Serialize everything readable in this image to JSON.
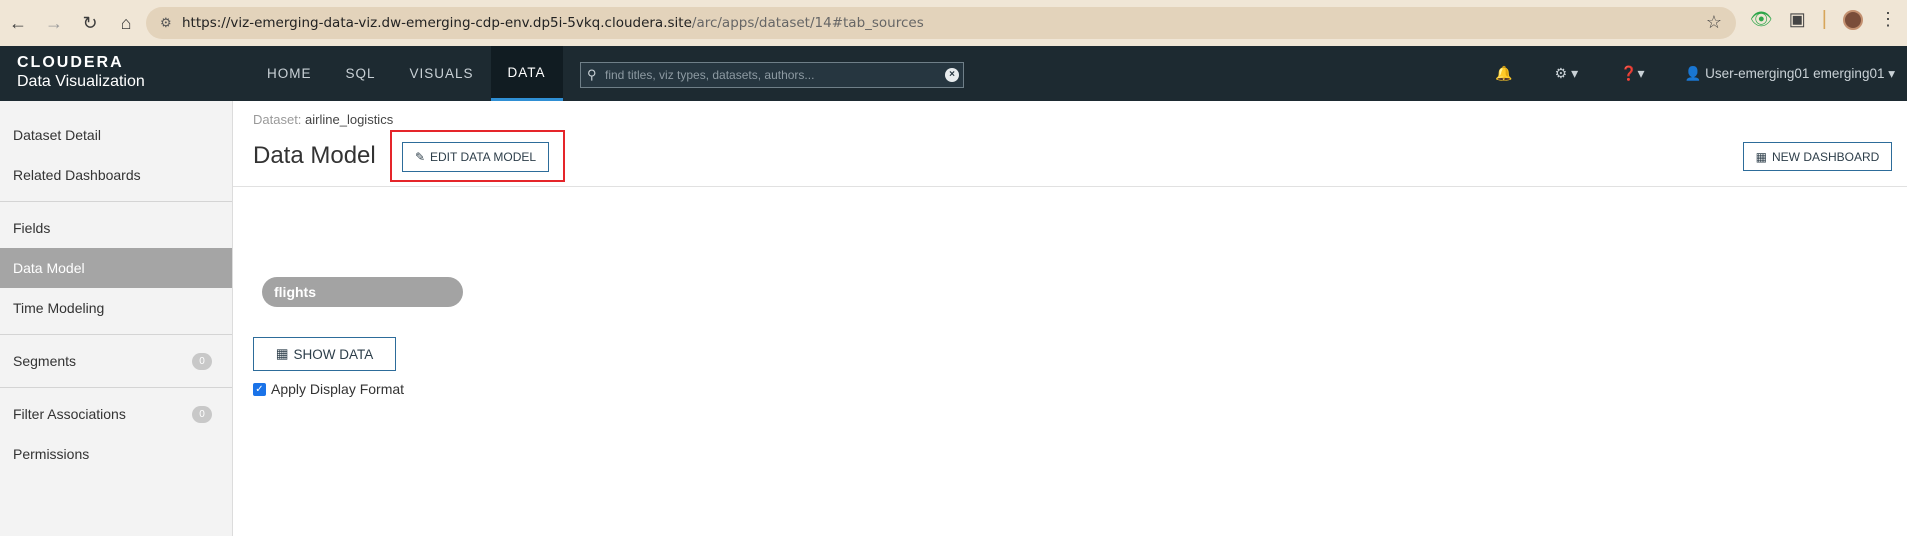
{
  "browser": {
    "url_host": "https://viz-emerging-data-viz.dw-emerging-cdp-env.dp5i-5vkq.cloudera.site",
    "url_path": "/arc/apps/dataset/14#tab_sources"
  },
  "brand": {
    "line1": "CLOUDERA",
    "line2": "Data Visualization"
  },
  "topnav": {
    "tabs": [
      "HOME",
      "SQL",
      "VISUALS",
      "DATA"
    ],
    "active": "DATA"
  },
  "search": {
    "placeholder": "find titles, viz types, datasets, authors..."
  },
  "user": {
    "label": "User-emerging01 emerging01"
  },
  "sidebar": {
    "items": [
      {
        "label": "Dataset Detail"
      },
      {
        "label": "Related Dashboards"
      },
      {
        "label": "Fields"
      },
      {
        "label": "Data Model"
      },
      {
        "label": "Time Modeling"
      },
      {
        "label": "Segments",
        "count": "0"
      },
      {
        "label": "Filter Associations",
        "count": "0"
      },
      {
        "label": "Permissions"
      }
    ],
    "active": "Data Model"
  },
  "main": {
    "breadcrumb_label": "Dataset:",
    "breadcrumb_value": "airline_logistics",
    "title": "Data Model",
    "edit_button": "EDIT DATA MODEL",
    "new_dashboard_button": "NEW DASHBOARD",
    "table_pill": "flights",
    "show_data_button": "SHOW DATA",
    "apply_display_format": "Apply Display Format"
  },
  "colors": {
    "header_bg": "#1d2a31",
    "accent": "#2f8fd4",
    "highlight": "#e5252a"
  }
}
